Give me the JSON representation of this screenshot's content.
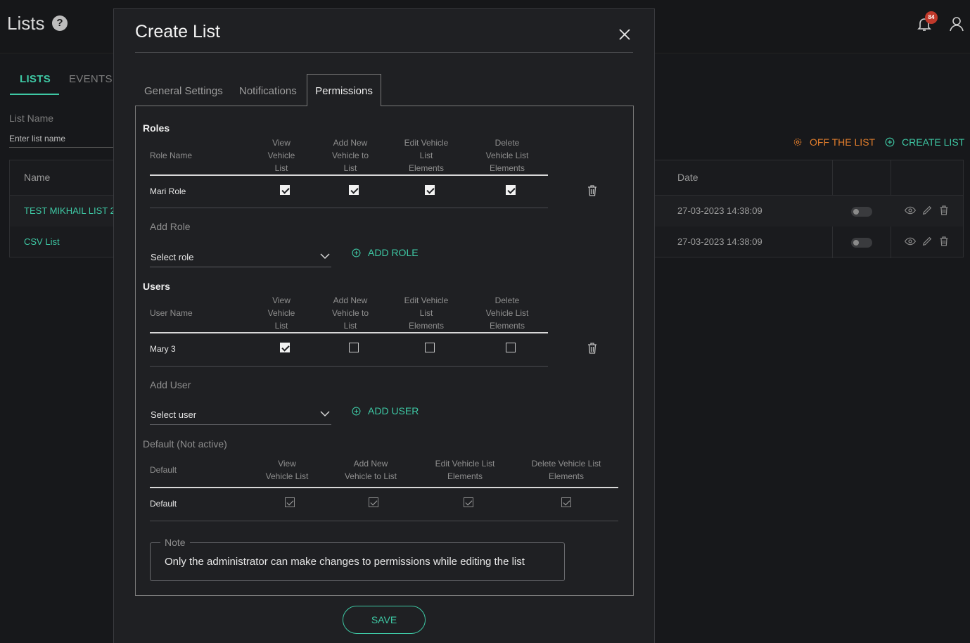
{
  "app": {
    "title": "Lists",
    "help_symbol": "?",
    "notification_count": "84"
  },
  "bg_tabs": {
    "lists": "LISTS",
    "events": "EVENTS"
  },
  "filter": {
    "label": "List Name",
    "placeholder": "Enter list name"
  },
  "actions": {
    "off_list": "OFF THE LIST",
    "create_list": "CREATE LIST"
  },
  "table": {
    "headers": {
      "name": "Name",
      "date": "Date"
    },
    "rows": [
      {
        "name": "TEST MIKHAIL LIST 2",
        "date": "27-03-2023 14:38:09"
      },
      {
        "name": "CSV List",
        "date": "27-03-2023 14:38:09"
      }
    ]
  },
  "modal": {
    "title": "Create List",
    "tabs": {
      "general": "General Settings",
      "notifications": "Notifications",
      "permissions": "Permissions"
    },
    "roles": {
      "title": "Roles",
      "name_header": "Role Name",
      "columns": [
        "View\nVehicle\nList",
        "Add New\nVehicle to\nList",
        "Edit Vehicle\nList\nElements",
        "Delete\nVehicle List\nElements"
      ],
      "rows": [
        {
          "name": "Mari Role",
          "perms": [
            true,
            true,
            true,
            true
          ]
        }
      ],
      "add_label": "Add Role",
      "select_value": "Select role",
      "add_button": "ADD ROLE"
    },
    "users": {
      "title": "Users",
      "name_header": "User Name",
      "columns": [
        "View\nVehicle\nList",
        "Add New\nVehicle to\nList",
        "Edit Vehicle\nList\nElements",
        "Delete\nVehicle List\nElements"
      ],
      "rows": [
        {
          "name": "Mary 3",
          "perms": [
            true,
            false,
            false,
            false
          ]
        }
      ],
      "add_label": "Add User",
      "select_value": "Select user",
      "add_button": "ADD USER"
    },
    "default": {
      "title": "Default (Not active)",
      "name_header": "Default",
      "columns": [
        "View\nVehicle List",
        "Add New\nVehicle to List",
        "Edit Vehicle List\nElements",
        "Delete Vehicle List\nElements"
      ],
      "rows": [
        {
          "name": "Default",
          "perms": [
            true,
            true,
            true,
            true
          ]
        }
      ]
    },
    "note": {
      "legend": "Note",
      "text": "Only the administrator can make changes to permissions while editing the list"
    },
    "save_label": "SAVE"
  },
  "colors": {
    "accent": "#3ec8a4",
    "warning": "#e07d2c",
    "badge": "#c0392b",
    "background": "#17181b",
    "modal": "#1f2023"
  },
  "icons": [
    "help-icon",
    "bell-icon",
    "user-icon",
    "gear-icon",
    "plus-circle-icon",
    "eye-icon",
    "pencil-icon",
    "trash-icon",
    "close-icon",
    "chevron-down-icon"
  ]
}
